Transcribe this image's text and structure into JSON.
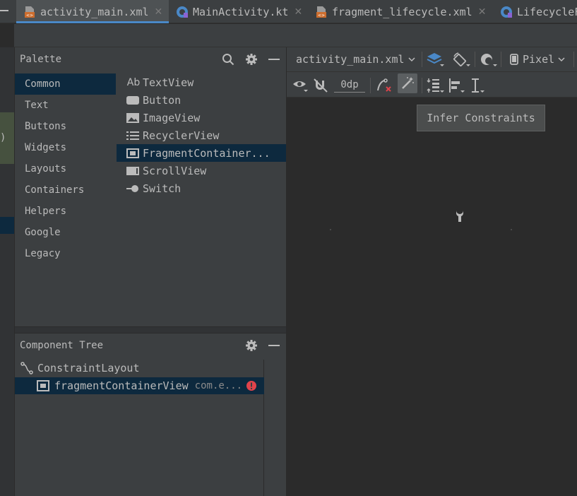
{
  "tabs": [
    {
      "label": "activity_main.xml",
      "active": true,
      "icon": "xml-file-icon",
      "closable": true
    },
    {
      "label": "MainActivity.kt",
      "active": false,
      "icon": "kotlin-file-icon",
      "closable": true
    },
    {
      "label": "fragment_lifecycle.xml",
      "active": false,
      "icon": "xml-file-icon",
      "closable": true
    },
    {
      "label": "LifecycleF",
      "active": false,
      "icon": "kotlin-file-icon",
      "closable": false
    }
  ],
  "tab_close_glyph": "✕",
  "left_edge_paren": ")",
  "palette": {
    "title": "Palette",
    "categories": [
      "Common",
      "Text",
      "Buttons",
      "Widgets",
      "Layouts",
      "Containers",
      "Helpers",
      "Google",
      "Legacy"
    ],
    "selected_category": "Common",
    "widgets": [
      {
        "label": "TextView",
        "icon": "textview-icon",
        "icon_text": "Ab"
      },
      {
        "label": "Button",
        "icon": "button-icon"
      },
      {
        "label": "ImageView",
        "icon": "image-icon"
      },
      {
        "label": "RecyclerView",
        "icon": "list-icon"
      },
      {
        "label": "FragmentContainer...",
        "icon": "fragment-icon",
        "selected": true
      },
      {
        "label": "ScrollView",
        "icon": "scrollview-icon"
      },
      {
        "label": "Switch",
        "icon": "switch-icon"
      }
    ]
  },
  "component_tree": {
    "title": "Component Tree",
    "root": "ConstraintLayout",
    "child": {
      "label": "fragmentContainerView",
      "detail": "com.e...",
      "error": true
    }
  },
  "design_toolbar": {
    "file_dropdown": "activity_main.xml",
    "device_dropdown": "Pixel",
    "margin_value": "0dp"
  },
  "tooltip": "Infer Constraints",
  "colors": {
    "background": "#2b2b2b",
    "panel": "#3c3f41",
    "selection": "#0d293e",
    "accent": "#4a88c7",
    "error": "#e0434b"
  }
}
